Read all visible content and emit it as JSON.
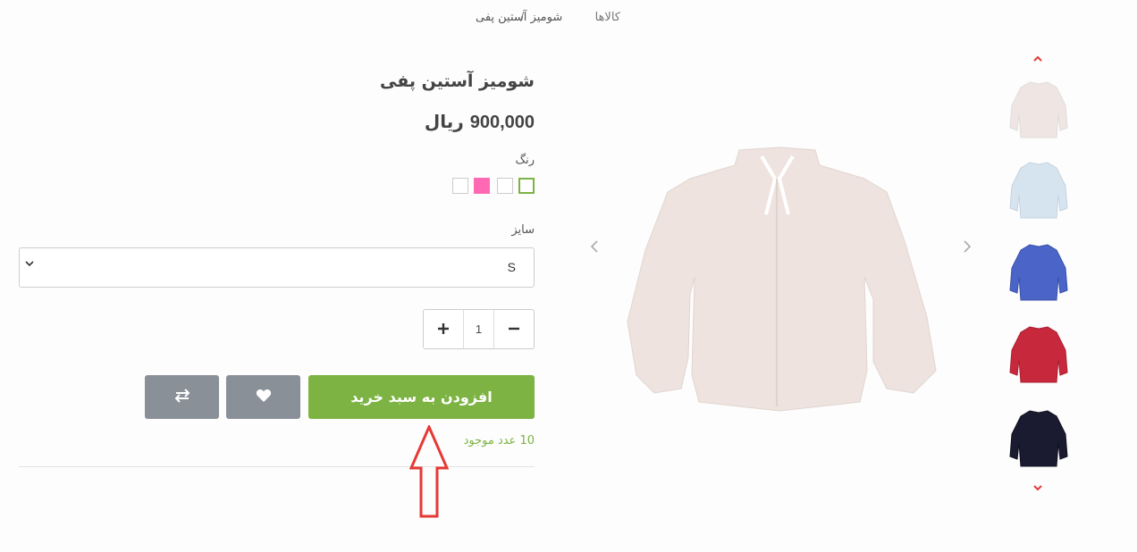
{
  "breadcrumb": {
    "items": [
      "کالاها",
      "شومیز آستین پفی"
    ],
    "separator": "/"
  },
  "product": {
    "title": "شومیز آستین پفی",
    "price_number": "900,000",
    "price_unit": "ریال",
    "color_label": "رنگ",
    "colors": [
      "#ffffff",
      "#ff69b4",
      "#ffffff",
      "#ffffff"
    ],
    "selected_color_index": 0,
    "size_label": "سایز",
    "size_value": "S",
    "quantity": "1",
    "add_to_cart_label": "افزودن به سبد خرید",
    "stock_text": "10 عدد موجود"
  },
  "gallery": {
    "thumbnails": [
      "cream-shirt",
      "light-blue-shirt",
      "blue-shirt",
      "red-shirt",
      "navy-shirt"
    ],
    "active_thumbnail_index": 0
  },
  "colors": {
    "accent_green": "#7cb342",
    "button_gray": "#8a9097",
    "arrow_red": "#e53935"
  },
  "icons": {
    "plus": "plus-icon",
    "minus": "minus-icon",
    "heart": "heart-icon",
    "compare": "compare-arrows-icon"
  }
}
